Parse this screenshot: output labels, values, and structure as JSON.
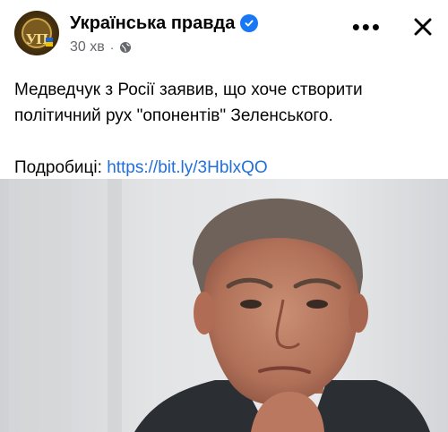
{
  "post": {
    "page_name": "Українська правда",
    "time": "30 хв",
    "separator": "·",
    "text_line1": "Медведчук з Росії заявив, що хоче створити",
    "text_line2": "політичний рух \"опонентів\" Зеленського.",
    "details_label": "Подробиці:",
    "link": "https://bit.ly/3HblxQO",
    "more_label": "•••",
    "avatar_monogram": "УП"
  },
  "colors": {
    "link": "#216fdb",
    "verified": "#1877f2",
    "secondary_text": "#65676b"
  },
  "icons": {
    "verified": "verified-badge-icon",
    "audience": "globe-icon",
    "more": "more-options-icon",
    "close": "close-icon"
  }
}
